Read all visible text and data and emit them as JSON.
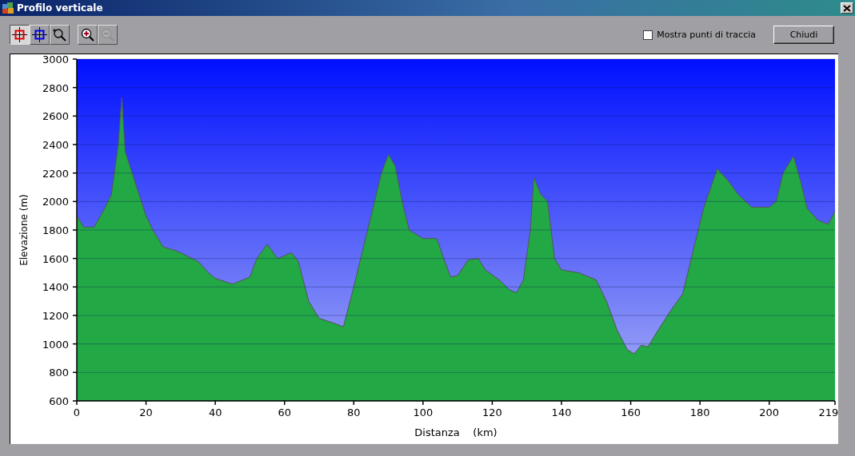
{
  "window": {
    "title": "Profilo verticale"
  },
  "tools": [
    {
      "kind": "measure",
      "selected": true,
      "disabled": false
    },
    {
      "kind": "cursor",
      "selected": false,
      "disabled": false
    },
    {
      "kind": "zoombox",
      "selected": false,
      "disabled": false
    },
    {
      "kind": "zoomin",
      "selected": false,
      "disabled": false
    },
    {
      "kind": "zoomout",
      "selected": false,
      "disabled": true
    }
  ],
  "show_points": {
    "label": "Mostra punti di traccia",
    "checked": false
  },
  "close_button": "Chiudi",
  "chart_data": {
    "type": "area",
    "xlabel": "Distanza    (km)",
    "ylabel": "Elevazione (m)",
    "x": [
      0,
      2,
      5,
      8,
      10,
      12,
      13,
      14,
      16,
      18,
      20,
      22,
      25,
      28,
      30,
      35,
      38,
      40,
      45,
      50,
      52,
      55,
      58,
      62,
      64,
      67,
      70,
      75,
      77,
      80,
      83,
      86,
      88,
      90,
      92,
      94,
      96,
      100,
      104,
      106,
      108,
      110,
      113,
      116,
      118,
      122,
      125,
      127,
      129,
      131,
      132,
      134,
      136,
      138,
      140,
      145,
      150,
      153,
      156,
      159,
      161,
      163,
      165,
      168,
      172,
      175,
      178,
      181,
      185,
      188,
      191,
      195,
      200,
      202,
      204,
      207,
      209,
      211,
      214,
      217,
      219
    ],
    "grid": true,
    "series": [
      {
        "color": "#22a844",
        "values": [
          1900,
          1820,
          1820,
          1950,
          2050,
          2400,
          2730,
          2350,
          2200,
          2050,
          1900,
          1800,
          1680,
          1660,
          1640,
          1580,
          1500,
          1460,
          1420,
          1470,
          1600,
          1700,
          1600,
          1640,
          1580,
          1300,
          1180,
          1140,
          1120,
          1400,
          1700,
          2000,
          2200,
          2330,
          2250,
          2000,
          1800,
          1740,
          1740,
          1600,
          1470,
          1480,
          1590,
          1600,
          1520,
          1450,
          1380,
          1360,
          1450,
          1800,
          2170,
          2050,
          2000,
          1600,
          1520,
          1500,
          1450,
          1300,
          1100,
          960,
          930,
          990,
          980,
          1100,
          1250,
          1350,
          1650,
          1950,
          2230,
          2150,
          2050,
          1960,
          1960,
          2000,
          2200,
          2320,
          2150,
          1950,
          1870,
          1840,
          1930
        ]
      }
    ],
    "xlim": [
      0,
      219
    ],
    "ylim": [
      600,
      3000
    ],
    "xticks": [
      0,
      20,
      40,
      60,
      80,
      100,
      120,
      140,
      160,
      180,
      200,
      219
    ],
    "yticks": [
      600,
      800,
      1000,
      1200,
      1400,
      1600,
      1800,
      2000,
      2200,
      2400,
      2600,
      2800,
      3000
    ]
  }
}
